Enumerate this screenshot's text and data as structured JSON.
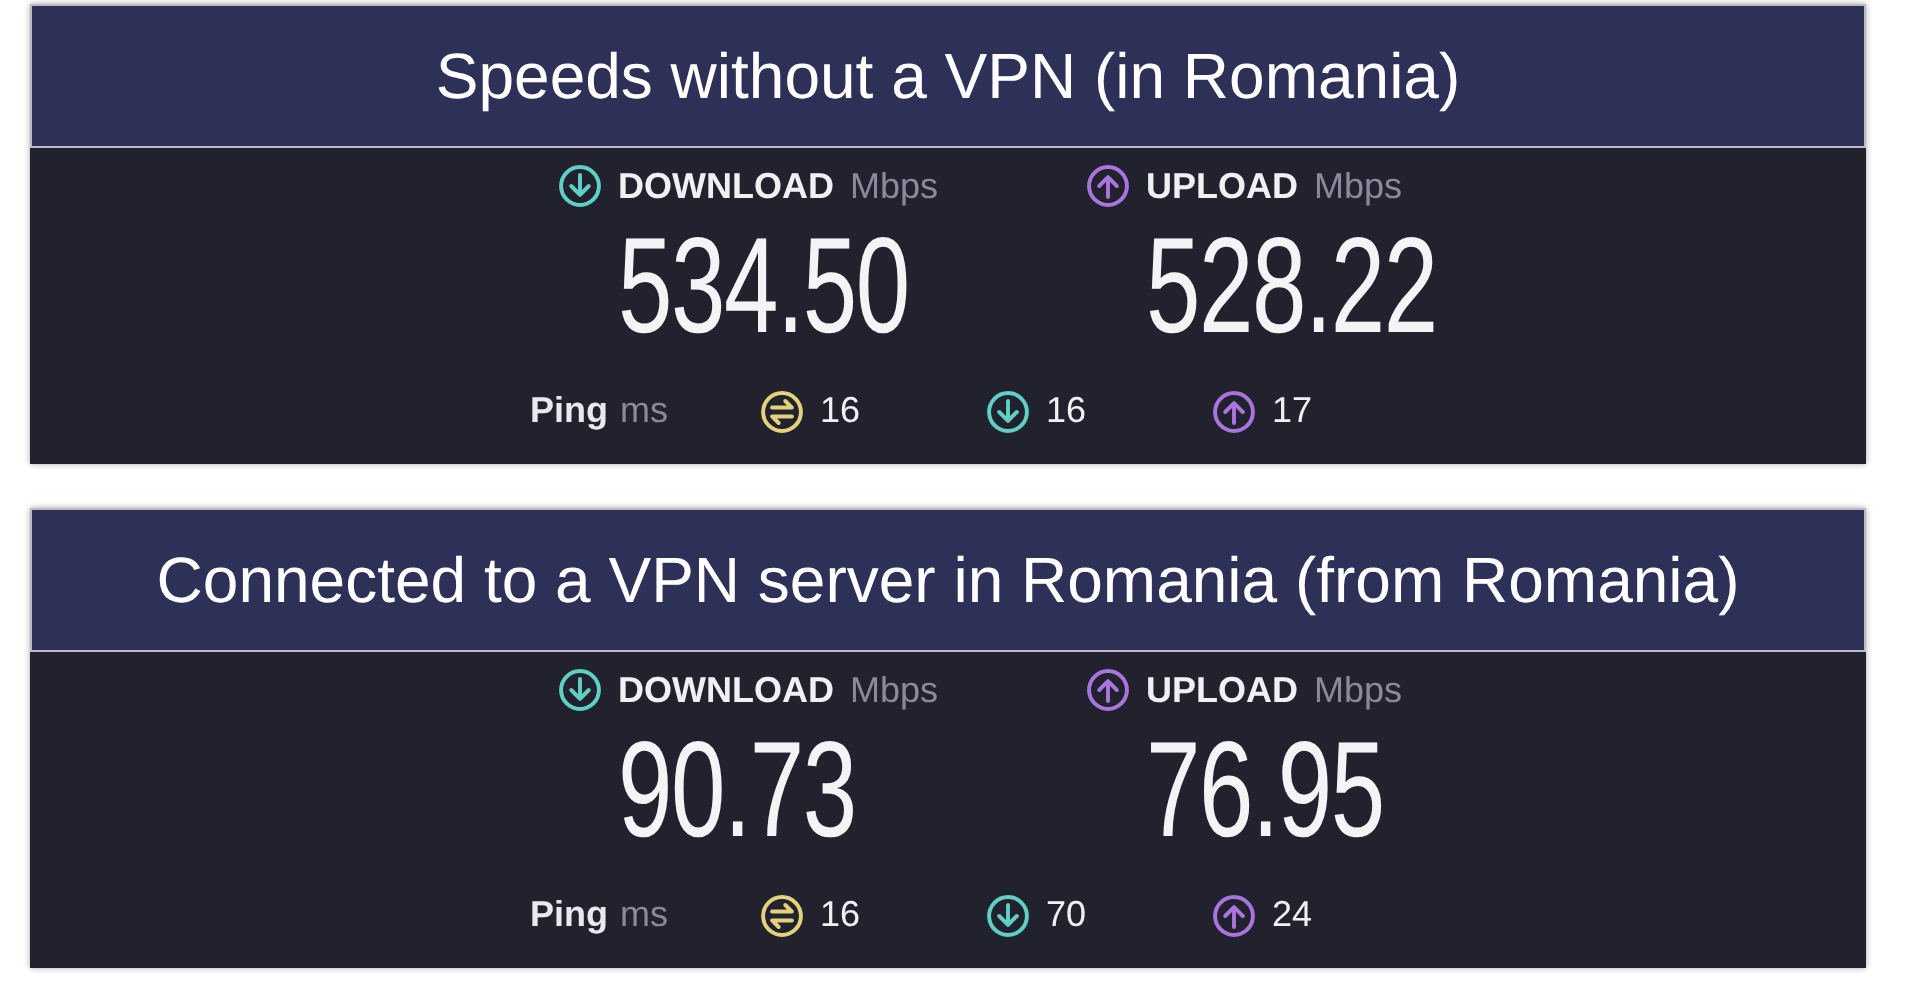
{
  "panels": [
    {
      "title": "Speeds without a VPN (in Romania)",
      "download": {
        "label": "DOWNLOAD",
        "unit": "Mbps",
        "value": "534.50"
      },
      "upload": {
        "label": "UPLOAD",
        "unit": "Mbps",
        "value": "528.22"
      },
      "ping": {
        "label": "Ping",
        "unit": "ms",
        "values": [
          {
            "kind": "idle",
            "value": "16"
          },
          {
            "kind": "download",
            "value": "16"
          },
          {
            "kind": "upload",
            "value": "17"
          }
        ]
      }
    },
    {
      "title": "Connected to a VPN server in Romania (from Romania)",
      "download": {
        "label": "DOWNLOAD",
        "unit": "Mbps",
        "value": "90.73"
      },
      "upload": {
        "label": "UPLOAD",
        "unit": "Mbps",
        "value": "76.95"
      },
      "ping": {
        "label": "Ping",
        "unit": "ms",
        "values": [
          {
            "kind": "idle",
            "value": "16"
          },
          {
            "kind": "download",
            "value": "70"
          },
          {
            "kind": "upload",
            "value": "24"
          }
        ]
      }
    }
  ]
}
